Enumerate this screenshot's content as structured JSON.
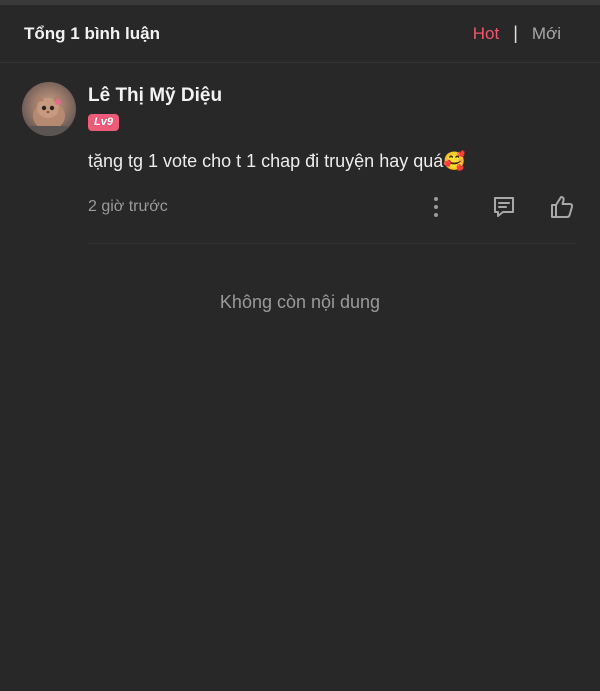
{
  "header": {
    "total_label": "Tổng 1 bình luận",
    "sort_hot": "Hot",
    "sort_separator": "|",
    "sort_new": "Mới",
    "active_sort_color": "#f0566c"
  },
  "comments": [
    {
      "username": "Lê Thị Mỹ Diệu",
      "level": "Lv9",
      "text": "tặng tg 1 vote cho t 1 chap đi truyện hay quá🥰",
      "time": "2 giờ trước",
      "icons": {
        "more": "more-vertical-icon",
        "reply": "comment-icon",
        "like": "thumbs-up-icon"
      }
    }
  ],
  "footer": {
    "empty_label": "Không còn nội dung"
  },
  "colors": {
    "background": "#282828",
    "level_badge": "#ee5b78"
  }
}
